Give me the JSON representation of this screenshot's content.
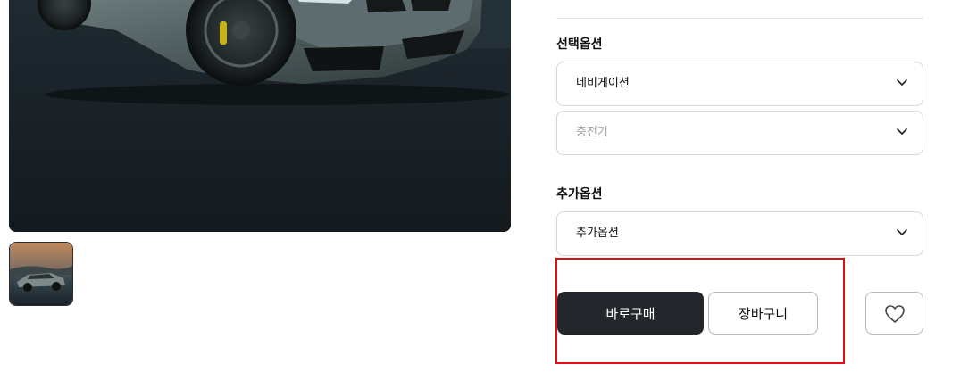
{
  "product": {
    "main_image_icon": "car-photo",
    "thumbnail_icon": "car-thumbnail"
  },
  "options": {
    "select_label": "선택옵션",
    "select_first_value": "네비게이션",
    "select_second_value": "충전기",
    "extra_label": "추가옵션",
    "extra_value": "추가옵션",
    "chevron_icon": "chevron-down-icon"
  },
  "actions": {
    "buy_label": "바로구매",
    "cart_label": "장바구니",
    "wish_icon": "heart-icon"
  },
  "colors": {
    "buy_button": "#23272b",
    "highlight": "#e01010",
    "border": "#d6d6d6"
  }
}
